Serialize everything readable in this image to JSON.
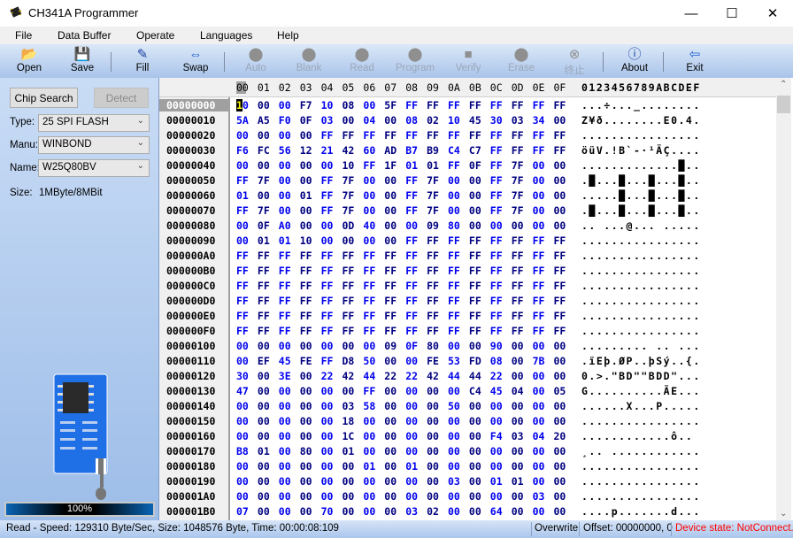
{
  "window": {
    "title": "CH341A Programmer",
    "minimize": "—",
    "maximize": "☐",
    "close": "✕"
  },
  "menu": [
    "File",
    "Data Buffer",
    "Operate",
    "Languages",
    "Help"
  ],
  "toolbar": [
    {
      "label": "Open",
      "icon": "📂",
      "enabled": true
    },
    {
      "label": "Save",
      "icon": "💾",
      "enabled": true
    },
    {
      "label": "Fill",
      "icon": "✎",
      "enabled": true
    },
    {
      "label": "Swap",
      "icon": "⇔",
      "enabled": true
    },
    {
      "label": "Auto",
      "icon": "⬤",
      "enabled": false
    },
    {
      "label": "Blank",
      "icon": "⬤",
      "enabled": false
    },
    {
      "label": "Read",
      "icon": "⬤",
      "enabled": false
    },
    {
      "label": "Program",
      "icon": "⬤",
      "enabled": false
    },
    {
      "label": "Verify",
      "icon": "■",
      "enabled": false
    },
    {
      "label": "Erase",
      "icon": "⬤",
      "enabled": false
    },
    {
      "label": "终止",
      "icon": "⊗",
      "enabled": false
    },
    {
      "label": "About",
      "icon": "ⓘ",
      "enabled": true
    },
    {
      "label": "Exit",
      "icon": "⇦",
      "enabled": true
    }
  ],
  "left": {
    "chip_search": "Chip Search",
    "detect": "Detect",
    "type_label": "Type:",
    "type_value": "25 SPI FLASH",
    "manu_label": "Manu:",
    "manu_value": "WINBOND",
    "name_label": "Name:",
    "name_value": "W25Q80BV",
    "size_label": "Size:",
    "size_value": "1MByte/8MBit",
    "progress_text": "100%",
    "progress": 100
  },
  "hex": {
    "columns": [
      "00",
      "01",
      "02",
      "03",
      "04",
      "05",
      "06",
      "07",
      "08",
      "09",
      "0A",
      "0B",
      "0C",
      "0D",
      "0E",
      "0F"
    ],
    "ascii_header": "0123456789ABCDEF",
    "rows": [
      {
        "addr": "00000000",
        "bytes": "10 00 00 F7 10 08 00 5F FF FF FF FF FF FF FF FF",
        "ascii": "...÷..._........"
      },
      {
        "addr": "00000010",
        "bytes": "5A A5 F0 0F 03 00 04 00 08 02 10 45 30 03 34 00",
        "ascii": "Z¥ð........E0.4."
      },
      {
        "addr": "00000020",
        "bytes": "00 00 00 00 FF FF FF FF FF FF FF FF FF FF FF FF",
        "ascii": "................"
      },
      {
        "addr": "00000030",
        "bytes": "F6 FC 56 12 21 42 60 AD B7 B9 C4 C7 FF FF FF FF",
        "ascii": "öüV.!B`-·¹ÄÇ...."
      },
      {
        "addr": "00000040",
        "bytes": "00 00 00 00 00 10 FF 1F 01 01 FF 0F FF 7F 00 00",
        "ascii": ".............█.."
      },
      {
        "addr": "00000050",
        "bytes": "FF 7F 00 00 FF 7F 00 00 FF 7F 00 00 FF 7F 00 00",
        "ascii": ".█...█...█...█.."
      },
      {
        "addr": "00000060",
        "bytes": "01 00 00 01 FF 7F 00 00 FF 7F 00 00 FF 7F 00 00",
        "ascii": ".....█...█...█.."
      },
      {
        "addr": "00000070",
        "bytes": "FF 7F 00 00 FF 7F 00 00 FF 7F 00 00 FF 7F 00 00",
        "ascii": ".█...█...█...█.."
      },
      {
        "addr": "00000080",
        "bytes": "00 0F A0 00 00 0D 40 00 00 09 80 00 00 00 00 00",
        "ascii": ".. ...@... ....."
      },
      {
        "addr": "00000090",
        "bytes": "00 01 01 10 00 00 00 00 FF FF FF FF FF FF FF FF",
        "ascii": "................"
      },
      {
        "addr": "000000A0",
        "bytes": "FF FF FF FF FF FF FF FF FF FF FF FF FF FF FF FF",
        "ascii": "................"
      },
      {
        "addr": "000000B0",
        "bytes": "FF FF FF FF FF FF FF FF FF FF FF FF FF FF FF FF",
        "ascii": "................"
      },
      {
        "addr": "000000C0",
        "bytes": "FF FF FF FF FF FF FF FF FF FF FF FF FF FF FF FF",
        "ascii": "................"
      },
      {
        "addr": "000000D0",
        "bytes": "FF FF FF FF FF FF FF FF FF FF FF FF FF FF FF FF",
        "ascii": "................"
      },
      {
        "addr": "000000E0",
        "bytes": "FF FF FF FF FF FF FF FF FF FF FF FF FF FF FF FF",
        "ascii": "................"
      },
      {
        "addr": "000000F0",
        "bytes": "FF FF FF FF FF FF FF FF FF FF FF FF FF FF FF FF",
        "ascii": "................"
      },
      {
        "addr": "00000100",
        "bytes": "00 00 00 00 00 00 00 09 0F 80 00 00 90 00 00 00",
        "ascii": "......... .. ..."
      },
      {
        "addr": "00000110",
        "bytes": "00 EF 45 FE FF D8 50 00 00 FE 53 FD 08 00 7B 00",
        "ascii": ".ïEþ.ØP..þSý..{."
      },
      {
        "addr": "00000120",
        "bytes": "30 00 3E 00 22 42 44 22 22 42 44 44 22 00 00 00",
        "ascii": "0.>.\"BD\"\"BDD\"..."
      },
      {
        "addr": "00000130",
        "bytes": "47 00 00 00 00 00 FF 00 00 00 00 C4 45 04 00 05",
        "ascii": "G..........ÄE..."
      },
      {
        "addr": "00000140",
        "bytes": "00 00 00 00 00 03 58 00 00 00 50 00 00 00 00 00",
        "ascii": "......X...P....."
      },
      {
        "addr": "00000150",
        "bytes": "00 00 00 00 00 18 00 00 00 00 00 00 00 00 00 00",
        "ascii": "................"
      },
      {
        "addr": "00000160",
        "bytes": "00 00 00 00 00 1C 00 00 00 00 00 00 F4 03 04 20",
        "ascii": "............ô.. "
      },
      {
        "addr": "00000170",
        "bytes": "B8 01 00 80 00 01 00 00 00 00 00 00 00 00 00 00",
        "ascii": "¸.. ............"
      },
      {
        "addr": "00000180",
        "bytes": "00 00 00 00 00 00 01 00 01 00 00 00 00 00 00 00",
        "ascii": "................"
      },
      {
        "addr": "00000190",
        "bytes": "00 00 00 00 00 00 00 00 00 00 03 00 01 01 00 00",
        "ascii": "................"
      },
      {
        "addr": "000001A0",
        "bytes": "00 00 00 00 00 00 00 00 00 00 00 00 00 00 03 00",
        "ascii": "................"
      },
      {
        "addr": "000001B0",
        "bytes": "07 00 00 00 70 00 00 00 03 02 00 00 64 00 00 00",
        "ascii": "....p.......d..."
      }
    ]
  },
  "status": {
    "message": "Read - Speed: 129310 Byte/Sec, Size: 1048576 Byte, Time: 00:00:08:109",
    "mode": "Overwrite",
    "offset": "Offset: 00000000, 0",
    "device_state": "Device state: NotConnect.",
    "device_state_color": "#ff0000"
  }
}
